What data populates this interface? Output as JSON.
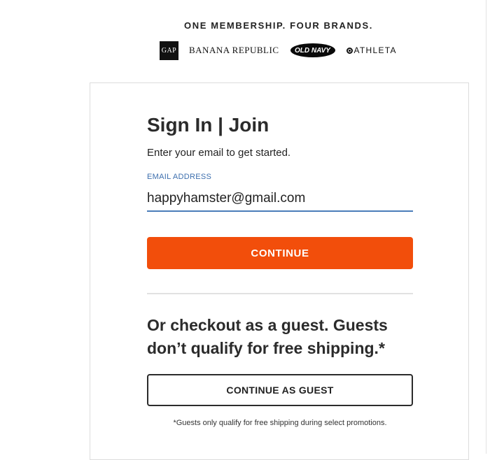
{
  "header": {
    "tagline": "ONE MEMBERSHIP. FOUR BRANDS.",
    "brands": {
      "gap": "GAP",
      "banana_republic": "BANANA REPUBLIC",
      "old_navy": "OLD NAVY",
      "athleta": "ATHLETA"
    }
  },
  "signin": {
    "title": "Sign In | Join",
    "subtitle": "Enter your email to get started.",
    "email_label": "EMAIL ADDRESS",
    "email_value": "happyhamster@gmail.com",
    "continue_label": "CONTINUE"
  },
  "guest": {
    "heading": "Or checkout as a guest. Guests don’t qualify for free shipping.*",
    "button_label": "CONTINUE AS GUEST",
    "footnote": "*Guests only qualify for free shipping during select promotions."
  },
  "colors": {
    "continue_button": "#f24e0b",
    "email_label": "#3d6fae",
    "email_underline": "#4a7db9"
  }
}
